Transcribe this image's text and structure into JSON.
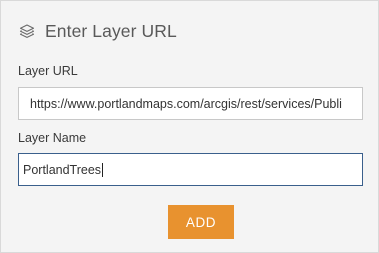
{
  "header": {
    "title": "Enter Layer URL",
    "icon": "layers-icon"
  },
  "fields": {
    "url": {
      "label": "Layer URL",
      "value": "https://www.portlandmaps.com/arcgis/rest/services/Publi"
    },
    "name": {
      "label": "Layer Name",
      "value": "PortlandTrees"
    }
  },
  "actions": {
    "add_label": "ADD"
  },
  "colors": {
    "panel_bg": "#f4f4f4",
    "accent_button": "#e8922f",
    "focus_border": "#3a5f8c",
    "title_text": "#595959"
  }
}
